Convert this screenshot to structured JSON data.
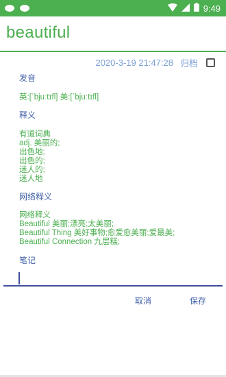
{
  "status_bar": {
    "time": "9:49",
    "left_icons": [
      "cloud-icon",
      "cloud-icon"
    ],
    "right_icons": [
      "wifi-icon",
      "signal-icon",
      "battery-icon"
    ]
  },
  "app_bar": {
    "title": "beautiful"
  },
  "meta": {
    "datetime": "2020-3-19 21:47:28",
    "archive_label": "归档",
    "archive_checked": false
  },
  "sections": {
    "pronunciation": {
      "title": "发音",
      "text": "英:[ˈbjuːtɪfl] 美:[ˈbjuːtɪfl]"
    },
    "definition": {
      "title": "释义",
      "lines": [
        "有道词典",
        "adj. 美丽的;",
        "出色地;",
        "出色的;",
        "迷人的;",
        "迷人地"
      ]
    },
    "web_definition": {
      "title": "网络释义",
      "lines": [
        "网络释义",
        "Beautiful 美丽;漂亮;太美丽;",
        "Beautiful Thing 美好事物;愈爱愈美丽;爱最美;",
        "Beautiful Connection 九层糕;"
      ]
    },
    "notes": {
      "title": "笔记",
      "input_value": ""
    }
  },
  "actions": {
    "cancel_label": "取消",
    "save_label": "保存"
  },
  "colors": {
    "accent_green": "#4caf50",
    "section_blue": "#3f5ea8",
    "meta_blue": "#7aa0d6"
  }
}
